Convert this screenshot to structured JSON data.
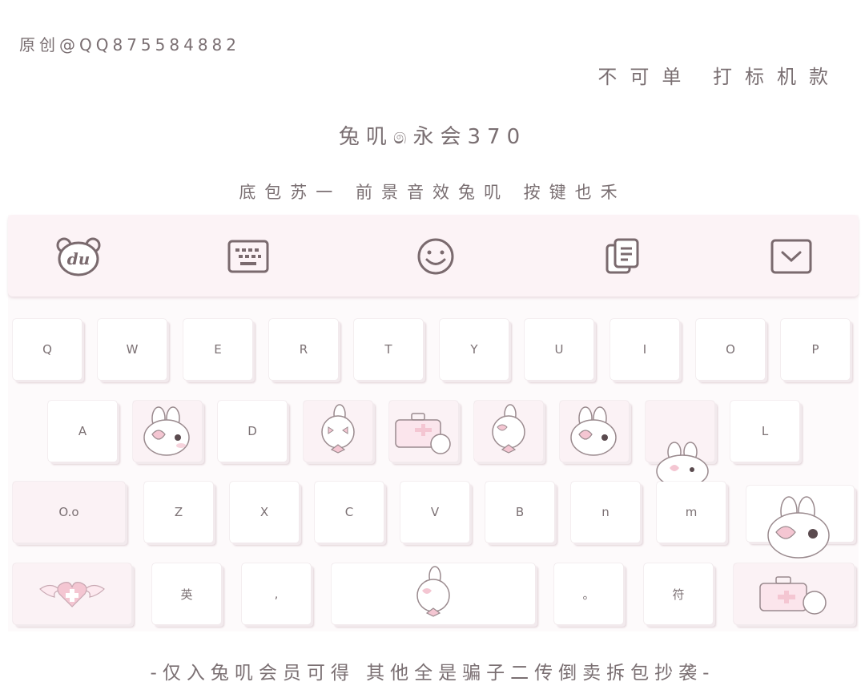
{
  "captions": {
    "original": "原创@QQ875584882",
    "notice": "不可单 打标机款",
    "title": "兔叽෧永会370",
    "subtitle": "底包苏一 前景音效兔叽 按键也禾",
    "footer": "-仅入兔叽会员可得 其他全是骗子二传倒卖拆包抄袭-"
  },
  "toolbar": [
    {
      "name": "du-logo-icon"
    },
    {
      "name": "keyboard-icon"
    },
    {
      "name": "emoji-icon"
    },
    {
      "name": "clipboard-icon"
    },
    {
      "name": "collapse-keyboard-icon"
    }
  ],
  "keys": {
    "row1": [
      "Q",
      "W",
      "E",
      "R",
      "T",
      "Y",
      "U",
      "I",
      "O",
      "P"
    ],
    "row2": [
      "A",
      "",
      "D",
      "",
      "",
      "",
      "",
      "",
      "L"
    ],
    "row3": [
      "O.o",
      "Z",
      "X",
      "C",
      "V",
      "B",
      "n",
      "m",
      ""
    ],
    "row4": [
      "",
      "英",
      ",",
      "",
      "。",
      "符",
      ""
    ]
  },
  "colors": {
    "accent": "#f4c6d2",
    "line": "#6b5a5e"
  }
}
